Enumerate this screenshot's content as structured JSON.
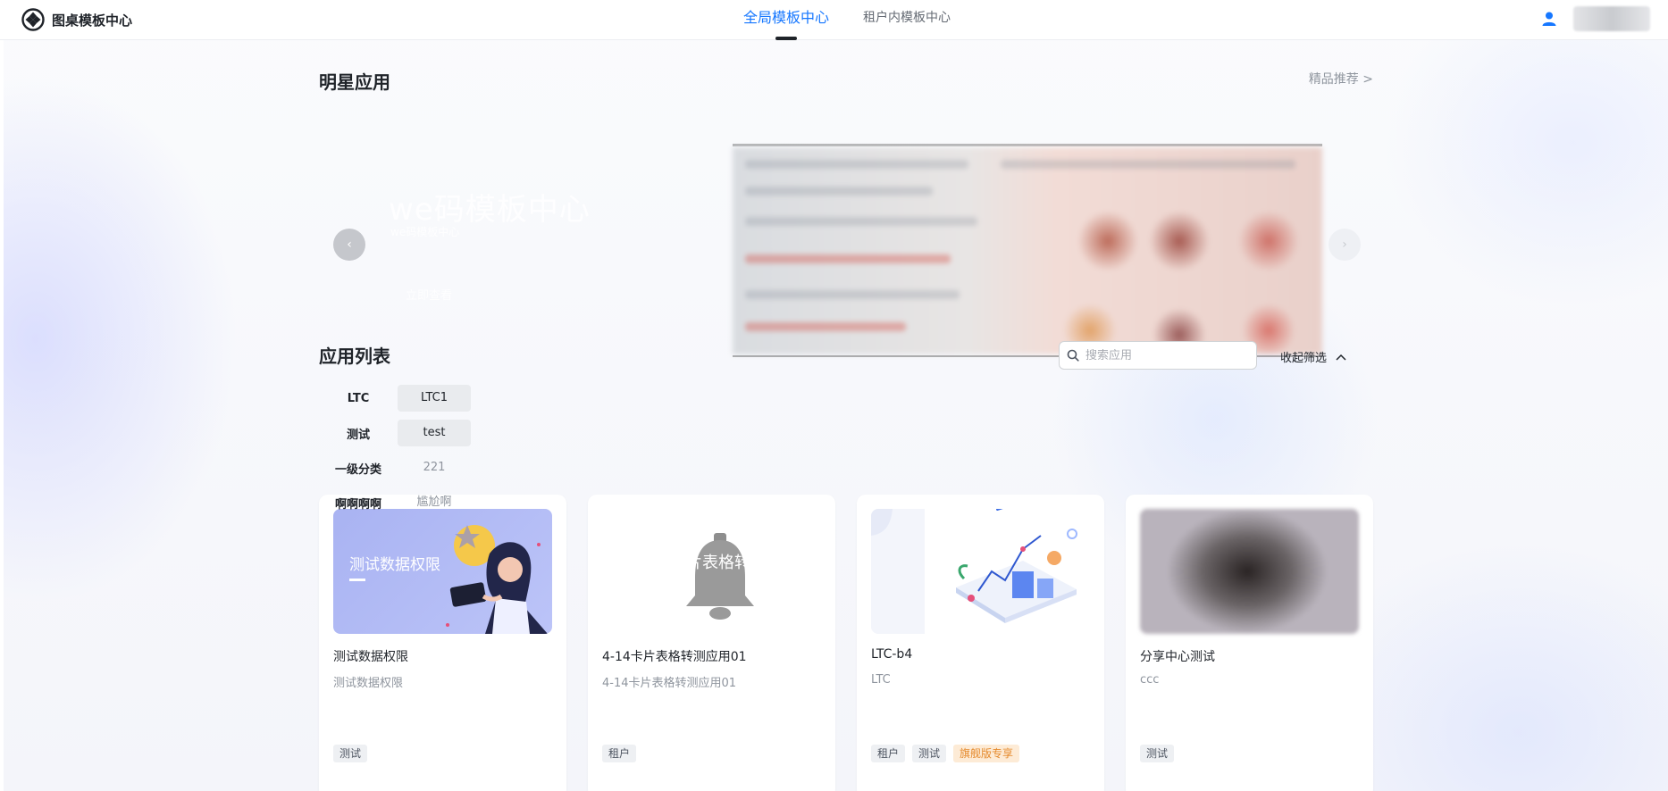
{
  "header": {
    "app_name": "图桌模板中心",
    "tabs": [
      {
        "label": "全局模板中心",
        "active": true
      },
      {
        "label": "租户内模板中心",
        "active": false
      }
    ],
    "accent_color": "#1677ff"
  },
  "featured": {
    "title": "明星应用",
    "more_label": "精品推荐 >",
    "banner_title": "we码模板中心",
    "banner_subtitle": "we码模板中心",
    "banner_button": "立即查看",
    "prev_glyph": "‹",
    "next_glyph": "›"
  },
  "app_list": {
    "title": "应用列表",
    "search_placeholder": "搜索应用",
    "collapse_label": "收起筛选",
    "filters": [
      {
        "label": "LTC",
        "tag": "LTC1",
        "selected": true
      },
      {
        "label": "测试",
        "tag": "test",
        "selected": true
      },
      {
        "label": "一级分类",
        "tag": "221",
        "selected": false
      },
      {
        "label": "啊啊啊啊",
        "tag": "尴尬啊",
        "selected": false
      }
    ],
    "cards": [
      {
        "title": "测试数据权限",
        "description": "测试数据权限",
        "thumb_text": "测试数据权限",
        "tags": [
          "测试"
        ]
      },
      {
        "title": "4-14卡片表格转测应用01",
        "description": "4-14卡片表格转测应用01",
        "thumb_text": "片表格转",
        "tags": [
          "租户"
        ]
      },
      {
        "title": "LTC-b4",
        "description": "LTC",
        "thumb_text": "",
        "tags": [
          "租户",
          "测试",
          "旗舰版专享"
        ]
      },
      {
        "title": "分享中心测试",
        "description": "ccc",
        "thumb_text": "",
        "tags": [
          "测试"
        ]
      }
    ]
  }
}
